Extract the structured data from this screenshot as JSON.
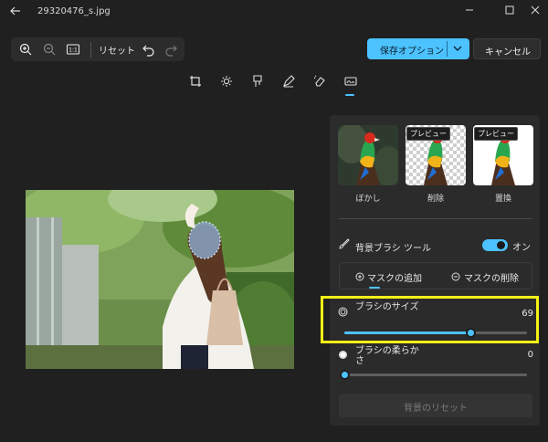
{
  "titlebar": {
    "filename": "29320476_s.jpg"
  },
  "toolbar": {
    "reset_label": "リセット",
    "save_label": "保存オプション",
    "cancel_label": "キャンセル",
    "zoom_fit_label": "1:1"
  },
  "background_panel": {
    "modes": [
      {
        "label": "ぼかし",
        "preview_badge": ""
      },
      {
        "label": "削除",
        "preview_badge": "プレビュー"
      },
      {
        "label": "置換",
        "preview_badge": "プレビュー"
      }
    ],
    "brush_tool_label": "背景ブラシ ツール",
    "brush_tool_state": "オン",
    "mask_add_label": "マスクの追加",
    "mask_remove_label": "マスクの削除",
    "brush_size": {
      "label": "ブラシのサイズ",
      "value": "69",
      "fraction": 0.69
    },
    "brush_softness": {
      "label": "ブラシの柔らかさ",
      "value": "0",
      "fraction": 0.0
    },
    "reset_background_label": "背景のリセット"
  },
  "colors": {
    "accent": "#4cc2ff",
    "highlight": "#f5ef17",
    "background": "#202020",
    "panel": "#2b2b2b"
  }
}
